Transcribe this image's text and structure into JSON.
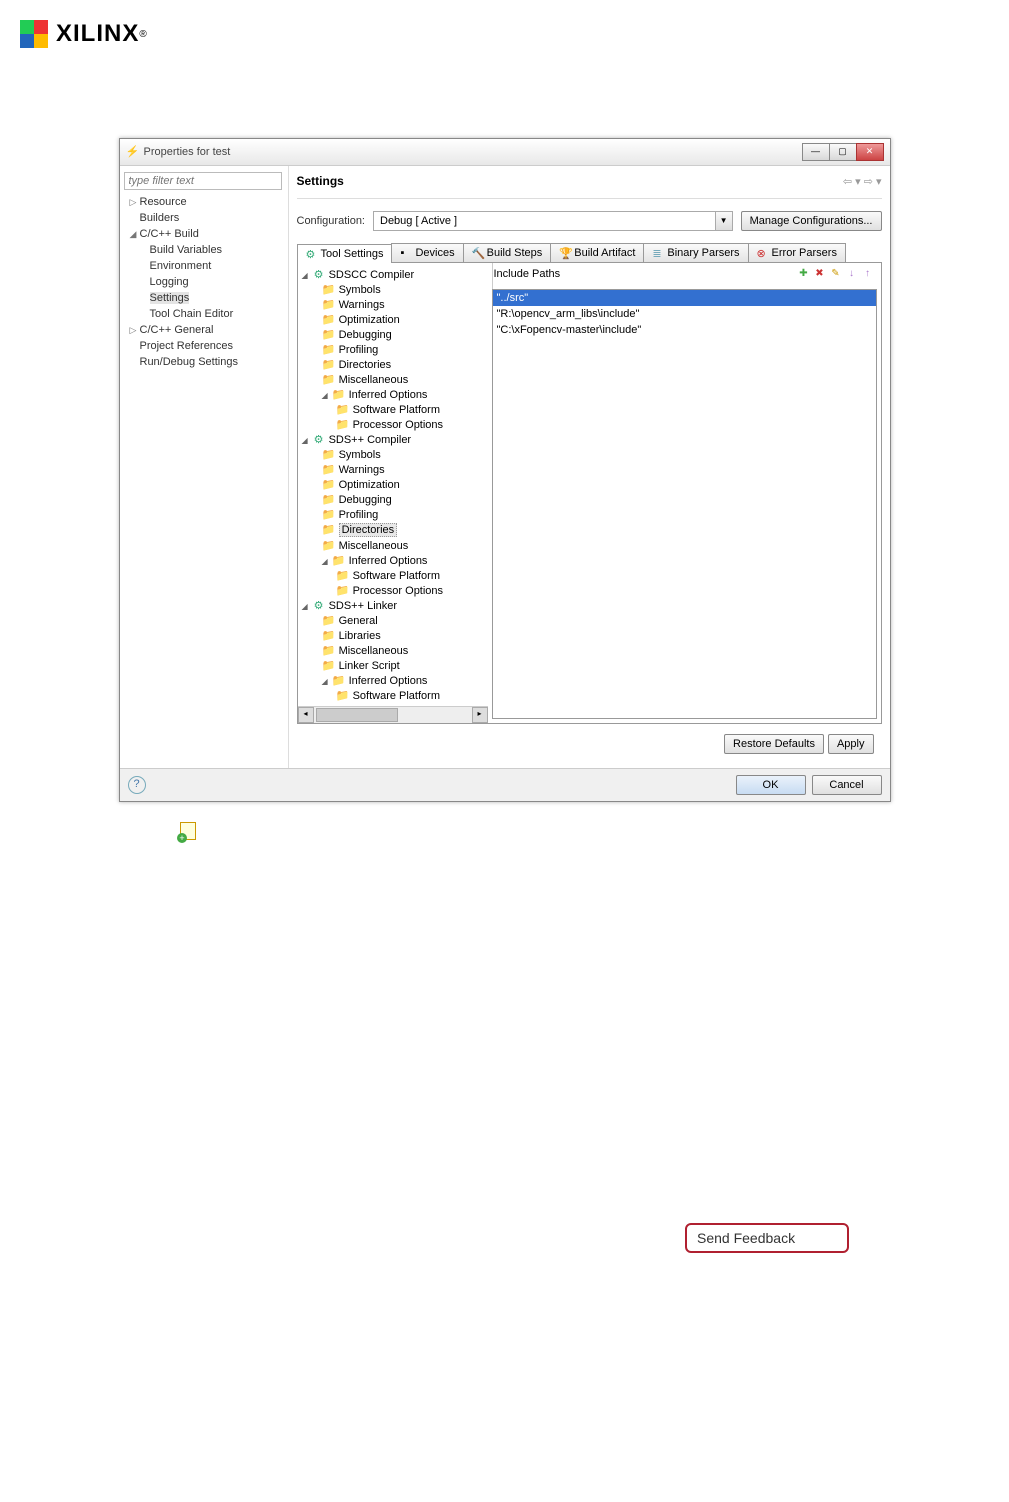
{
  "brand": {
    "name": "XILINX",
    "dot": "®"
  },
  "dialog": {
    "title": "Properties for test",
    "filterPlaceholder": "type filter text",
    "nav": {
      "resource": "Resource",
      "builders": "Builders",
      "build": "C/C++ Build",
      "buildVars": "Build Variables",
      "environment": "Environment",
      "logging": "Logging",
      "settings": "Settings",
      "toolchain": "Tool Chain Editor",
      "general": "C/C++ General",
      "projRefs": "Project References",
      "runDebug": "Run/Debug Settings"
    },
    "mainTitle": "Settings",
    "configLabel": "Configuration:",
    "configValue": "Debug  [ Active ]",
    "manageBtn": "Manage Configurations...",
    "tabs": {
      "tool": "Tool Settings",
      "devices": "Devices",
      "steps": "Build Steps",
      "artifact": "Build Artifact",
      "binary": "Binary Parsers",
      "error": "Error Parsers"
    },
    "toolTree": {
      "sdscc": "SDSCC Compiler",
      "symbols": "Symbols",
      "warnings": "Warnings",
      "optim": "Optimization",
      "debug": "Debugging",
      "profile": "Profiling",
      "dirs": "Directories",
      "misc": "Miscellaneous",
      "inferred": "Inferred Options",
      "swplat": "Software Platform",
      "procopt": "Processor Options",
      "sdspp": "SDS++ Compiler",
      "linker": "SDS++ Linker",
      "general": "General",
      "libs": "Libraries",
      "lscript": "Linker Script"
    },
    "includeTitle": "Include Paths",
    "includePaths": [
      "\"../src\"",
      "\"R:\\opencv_arm_libs\\include\"",
      "\"C:\\xFopencv-master\\include\""
    ],
    "restoreBtn": "Restore Defaults",
    "applyBtn": "Apply",
    "okBtn": "OK",
    "cancelBtn": "Cancel"
  },
  "feedback": "Send Feedback"
}
